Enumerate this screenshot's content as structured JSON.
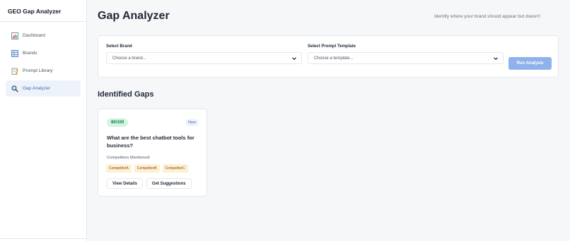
{
  "sidebar": {
    "app_title": "GEO Gap Analyzer",
    "items": [
      {
        "label": "Dashboard",
        "icon": "chart-icon",
        "active": false
      },
      {
        "label": "Brands",
        "icon": "table-icon",
        "active": false
      },
      {
        "label": "Prompt Library",
        "icon": "notepad-icon",
        "active": false
      },
      {
        "label": "Gap Analyzer",
        "icon": "magnifier-icon",
        "active": true
      }
    ]
  },
  "header": {
    "title": "Gap Analyzer",
    "subtitle": "Identify where your brand should appear but doesn't"
  },
  "form": {
    "brand_label": "Select Brand",
    "brand_value": "Choose a brand...",
    "template_label": "Select Prompt Template",
    "template_value": "Choose a template...",
    "run_label": "Run Analysis"
  },
  "gaps": {
    "title": "Identified Gaps",
    "card": {
      "score": "80/100",
      "status": "New",
      "question": "What are the best chatbot tools for business?",
      "competitors_label": "Competitors Mentioned:",
      "competitors": [
        "CompetitorA",
        "CompetitorB",
        "CompetitorC"
      ],
      "view_label": "View Details",
      "suggest_label": "Get Suggestions"
    }
  },
  "colors": {
    "accent": "#3b6bb5",
    "run_button": "#8fb2ea",
    "score_bg": "#d1f5e0",
    "chip_bg": "#fdf1d3"
  }
}
